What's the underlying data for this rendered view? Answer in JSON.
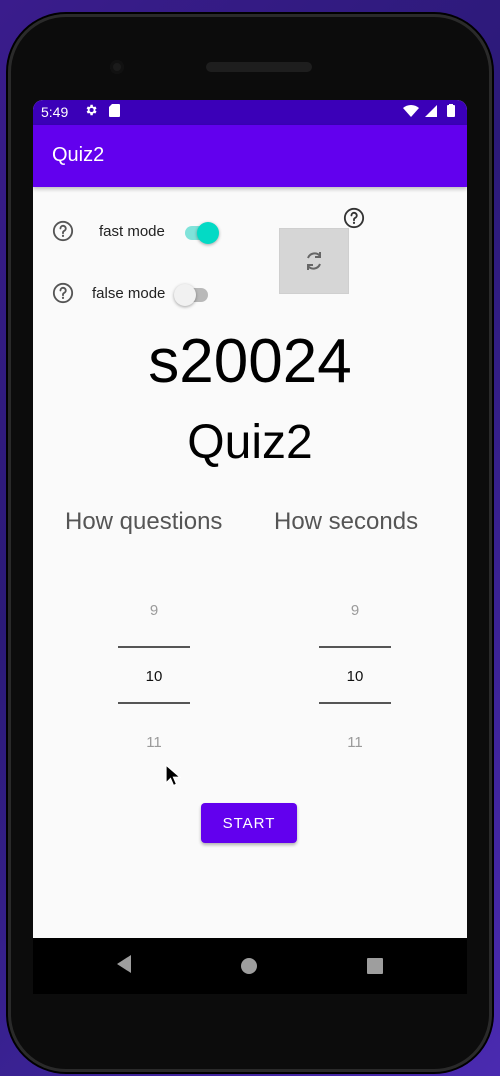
{
  "status": {
    "time": "5:49",
    "icons": [
      "gear-icon",
      "sd-card-icon",
      "wifi-icon",
      "signal-icon",
      "battery-icon"
    ]
  },
  "appbar": {
    "title": "Quiz2"
  },
  "settings": {
    "fast_mode": {
      "label": "fast mode",
      "on": true
    },
    "false_mode": {
      "label": "false mode",
      "on": false
    }
  },
  "main": {
    "student_id": "s20024",
    "title": "Quiz2",
    "questions_label": "How questions",
    "seconds_label": "How seconds"
  },
  "pickers": {
    "questions": {
      "prev": "9",
      "current": "10",
      "next": "11"
    },
    "seconds": {
      "prev": "9",
      "current": "10",
      "next": "11"
    }
  },
  "start_label": "START",
  "colors": {
    "primary": "#6200ee",
    "status_bar": "#3b00b8",
    "accent": "#03dac5"
  }
}
